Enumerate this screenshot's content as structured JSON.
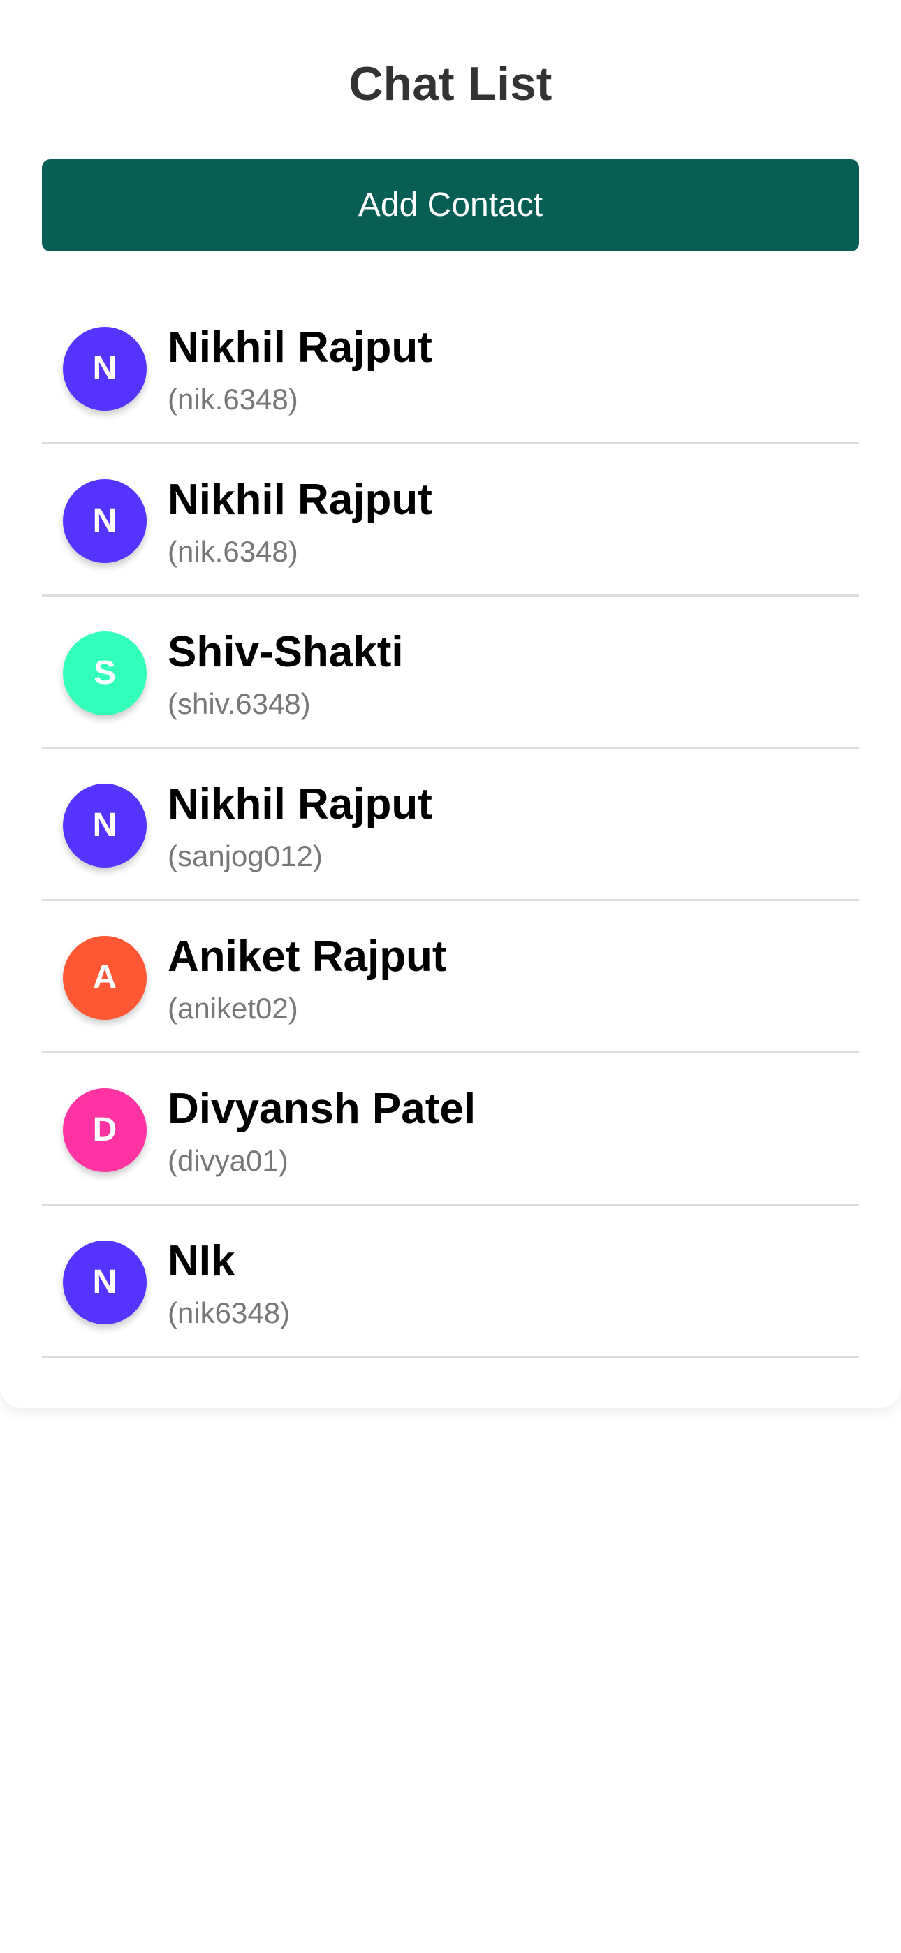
{
  "header": {
    "title": "Chat List"
  },
  "actions": {
    "add_contact_label": "Add Contact"
  },
  "colors": {
    "button_bg": "#075e54",
    "title_text": "#333333",
    "username_text": "#777777",
    "divider": "#dddddd"
  },
  "contacts": [
    {
      "initial": "N",
      "name": "Nikhil Rajput",
      "username": "(nik.6348)",
      "avatar_color": "#5733ff"
    },
    {
      "initial": "N",
      "name": "Nikhil Rajput",
      "username": "(nik.6348)",
      "avatar_color": "#5733ff"
    },
    {
      "initial": "S",
      "name": "Shiv-Shakti",
      "username": "(shiv.6348)",
      "avatar_color": "#33ffbd"
    },
    {
      "initial": "N",
      "name": "Nikhil Rajput",
      "username": "(sanjog012)",
      "avatar_color": "#5733ff"
    },
    {
      "initial": "A",
      "name": "Aniket Rajput",
      "username": "(aniket02)",
      "avatar_color": "#ff5733"
    },
    {
      "initial": "D",
      "name": "Divyansh Patel",
      "username": "(divya01)",
      "avatar_color": "#ff33a1"
    },
    {
      "initial": "N",
      "name": "NIk",
      "username": "(nik6348)",
      "avatar_color": "#5733ff"
    }
  ]
}
